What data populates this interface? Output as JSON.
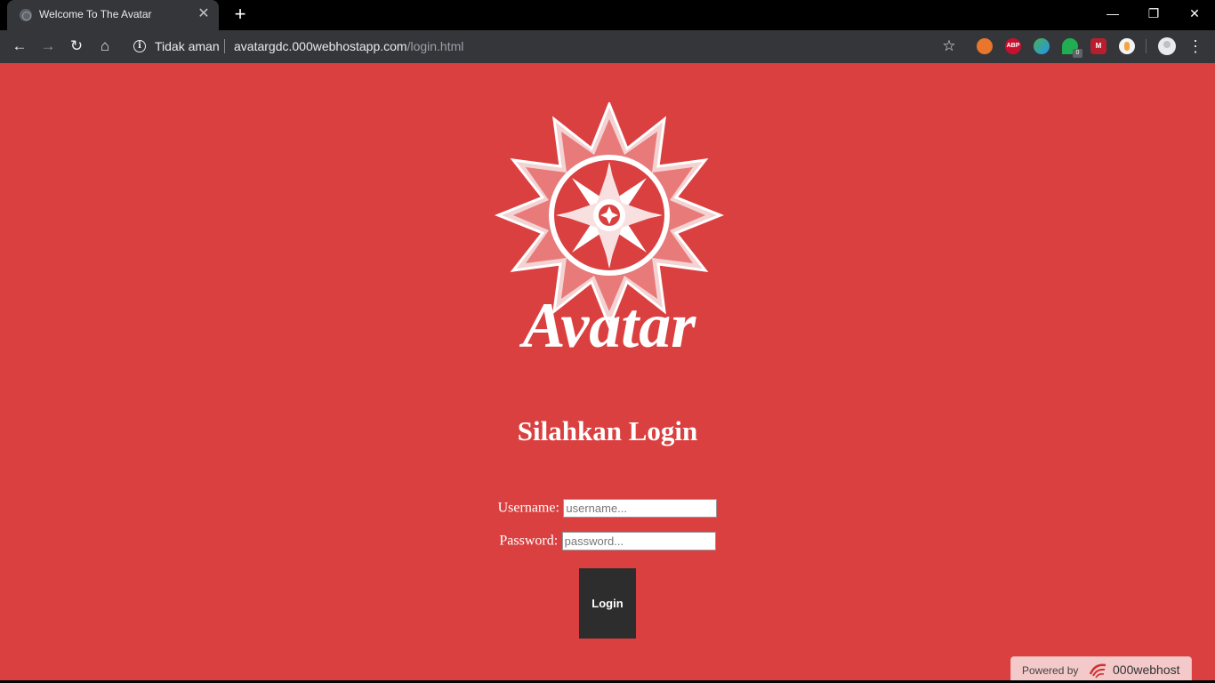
{
  "browser": {
    "tab_title": "Welcome To The Avatar",
    "security_text": "Tidak aman",
    "url_host": "avatargdc.000webhostapp.com",
    "url_path": "/login.html",
    "ext_badge_count": "0"
  },
  "logo": {
    "wordmark": "Avatar"
  },
  "login": {
    "heading": "Silahkan Login",
    "username_label": "Username:",
    "username_placeholder": "username...",
    "username_value": "",
    "password_label": "Password:",
    "password_placeholder": "password...",
    "password_value": "",
    "submit_label": "Login"
  },
  "footer": {
    "powered_by": "Powered by",
    "brand": "000webhost"
  },
  "colors": {
    "page_background": "#da4040",
    "button_background": "#2d2d2d"
  }
}
